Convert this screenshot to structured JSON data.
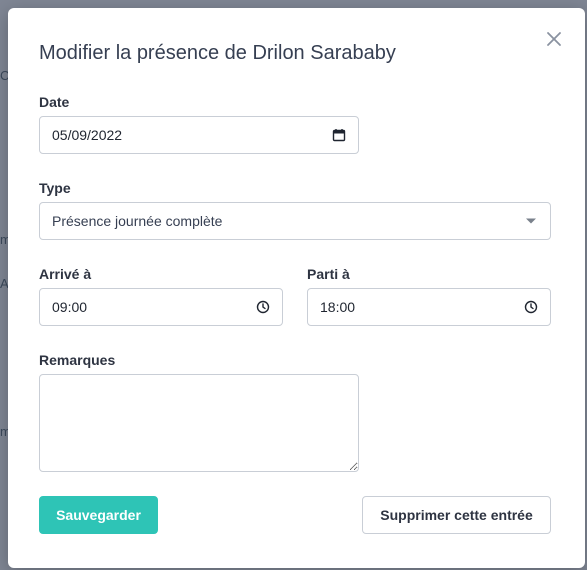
{
  "backdrop": {
    "fragments": [
      "C",
      "m",
      "A",
      "m"
    ]
  },
  "modal": {
    "title": "Modifier la présence de Drilon Sarababy",
    "date": {
      "label": "Date",
      "value": "05/09/2022"
    },
    "type": {
      "label": "Type",
      "value": "Présence journée complète"
    },
    "arrival": {
      "label": "Arrivé à",
      "value": "09:00"
    },
    "departure": {
      "label": "Parti à",
      "value": "18:00"
    },
    "remarks": {
      "label": "Remarques",
      "value": ""
    },
    "save_label": "Sauvegarder",
    "delete_label": "Supprimer cette entrée"
  },
  "colors": {
    "accent": "#2ec4b6",
    "overlay": "#7f8694"
  },
  "icons": [
    "close-icon",
    "calendar-icon",
    "caret-down-icon",
    "clock-icon",
    "resize-handle-icon"
  ]
}
